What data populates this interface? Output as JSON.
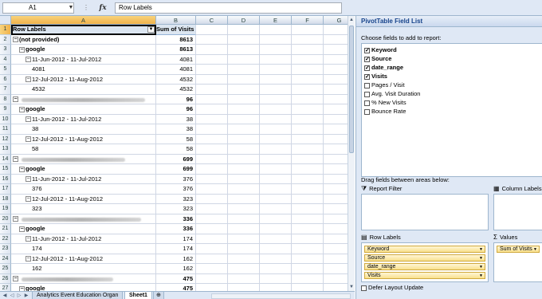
{
  "formula_bar": {
    "name_box": "A1",
    "fx": "fx",
    "formula": "Row Labels"
  },
  "columns": [
    "A",
    "B",
    "C",
    "D",
    "E",
    "F",
    "G"
  ],
  "header_row": {
    "row_labels": "Row Labels",
    "sum_of_visits": "Sum of Visits"
  },
  "rows": [
    {
      "n": "1"
    },
    {
      "n": "2",
      "label": "(not provided)",
      "value": "8613",
      "bold": true,
      "indent": 0,
      "btn": "−"
    },
    {
      "n": "3",
      "label": "google",
      "value": "8613",
      "bold": true,
      "indent": 1,
      "btn": "−"
    },
    {
      "n": "4",
      "label": "11-Jun-2012 - 11-Jul-2012",
      "value": "4081",
      "indent": 2,
      "btn": "−"
    },
    {
      "n": "5",
      "label": "4081",
      "value": "4081",
      "indent": 3
    },
    {
      "n": "6",
      "label": "12-Jul-2012 - 11-Aug-2012",
      "value": "4532",
      "indent": 2,
      "btn": "−"
    },
    {
      "n": "7",
      "label": "4532",
      "value": "4532",
      "indent": 3
    },
    {
      "n": "8",
      "label": "",
      "value": "96",
      "bold": true,
      "indent": 0,
      "btn": "−",
      "blur": 155
    },
    {
      "n": "9",
      "label": "google",
      "value": "96",
      "bold": true,
      "indent": 1,
      "btn": "−"
    },
    {
      "n": "10",
      "label": "11-Jun-2012 - 11-Jul-2012",
      "value": "38",
      "indent": 2,
      "btn": "−"
    },
    {
      "n": "11",
      "label": "38",
      "value": "38",
      "indent": 3
    },
    {
      "n": "12",
      "label": "12-Jul-2012 - 11-Aug-2012",
      "value": "58",
      "indent": 2,
      "btn": "−"
    },
    {
      "n": "13",
      "label": "58",
      "value": "58",
      "indent": 3
    },
    {
      "n": "14",
      "label": "",
      "value": "699",
      "bold": true,
      "indent": 0,
      "btn": "−",
      "blur": 130
    },
    {
      "n": "15",
      "label": "google",
      "value": "699",
      "bold": true,
      "indent": 1,
      "btn": "−"
    },
    {
      "n": "16",
      "label": "11-Jun-2012 - 11-Jul-2012",
      "value": "376",
      "indent": 2,
      "btn": "−"
    },
    {
      "n": "17",
      "label": "376",
      "value": "376",
      "indent": 3
    },
    {
      "n": "18",
      "label": "12-Jul-2012 - 11-Aug-2012",
      "value": "323",
      "indent": 2,
      "btn": "−"
    },
    {
      "n": "19",
      "label": "323",
      "value": "323",
      "indent": 3
    },
    {
      "n": "20",
      "label": "",
      "value": "336",
      "bold": true,
      "indent": 0,
      "btn": "−",
      "blur": 150
    },
    {
      "n": "21",
      "label": "google",
      "value": "336",
      "bold": true,
      "indent": 1,
      "btn": "−"
    },
    {
      "n": "22",
      "label": "11-Jun-2012 - 11-Jul-2012",
      "value": "174",
      "indent": 2,
      "btn": "−"
    },
    {
      "n": "23",
      "label": "174",
      "value": "174",
      "indent": 3
    },
    {
      "n": "24",
      "label": "12-Jul-2012 - 11-Aug-2012",
      "value": "162",
      "indent": 2,
      "btn": "−"
    },
    {
      "n": "25",
      "label": "162",
      "value": "162",
      "indent": 3
    },
    {
      "n": "26",
      "label": "",
      "value": "475",
      "bold": true,
      "indent": 0,
      "btn": "−",
      "blur": 115
    },
    {
      "n": "27",
      "label": "google",
      "value": "475",
      "bold": true,
      "indent": 1,
      "btn": "−"
    }
  ],
  "sheet_tabs": [
    "Analytics Event Education Organ",
    "Sheet1"
  ],
  "active_tab": "Sheet1",
  "panel": {
    "title": "PivotTable Field List",
    "choose_label": "Choose fields to add to report:",
    "fields": [
      {
        "name": "Keyword",
        "checked": true
      },
      {
        "name": "Source",
        "checked": true
      },
      {
        "name": "date_range",
        "checked": true
      },
      {
        "name": "Visits",
        "checked": true
      },
      {
        "name": "Pages / Visit",
        "checked": false
      },
      {
        "name": "Avg. Visit Duration",
        "checked": false
      },
      {
        "name": "% New Visits",
        "checked": false
      },
      {
        "name": "Bounce Rate",
        "checked": false
      }
    ],
    "drag_label": "Drag fields between areas below:",
    "report_filter": "Report Filter",
    "column_labels": "Column Labels",
    "row_labels": "Row Labels",
    "values": "Values",
    "row_fields": [
      "Keyword",
      "Source",
      "date_range",
      "Visits"
    ],
    "value_fields": [
      "Sum of Visits"
    ],
    "defer_label": "Defer Layout Update"
  }
}
